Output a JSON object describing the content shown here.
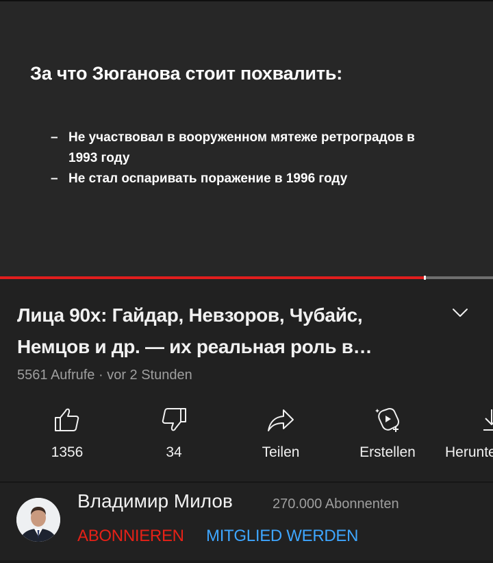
{
  "video": {
    "slide_title": "За что Зюганова стоит похвалить:",
    "bullets": [
      "Не участвовал в вооруженном мятеже ретроградов в 1993 году",
      "Не стал оспаривать поражение в 1996 году"
    ],
    "bullet_dash": "–",
    "progress": 0.86
  },
  "info": {
    "title": "Лица 90х: Гайдар, Невзоров, Чубайс, Немцов и др. — их  реальная роль в истории",
    "meta": "5561 Aufrufe · vor 2 Stunden",
    "expand_icon": "chevron-down-icon"
  },
  "actions": [
    {
      "name": "like-button",
      "icon": "thumbs-up-icon",
      "label": "1356"
    },
    {
      "name": "dislike-button",
      "icon": "thumbs-down-icon",
      "label": "34"
    },
    {
      "name": "share-button",
      "icon": "share-arrow-icon",
      "label": "Teilen"
    },
    {
      "name": "create-button",
      "icon": "create-sparkle-icon",
      "label": "Erstellen"
    },
    {
      "name": "download-button",
      "icon": "download-icon",
      "label": "Herunterladen"
    }
  ],
  "channel": {
    "name": "Владимир Милов",
    "subscribers": "270.000 Abonnenten",
    "subscribe_label": "ABONNIEREN",
    "member_label": "MITGLIED WERDEN"
  },
  "colors": {
    "background": "#212121",
    "accent_red": "#e62117",
    "progress_red": "#e11d1d",
    "link_blue": "#3ea6ff",
    "secondary_text": "#9f9f9f"
  }
}
